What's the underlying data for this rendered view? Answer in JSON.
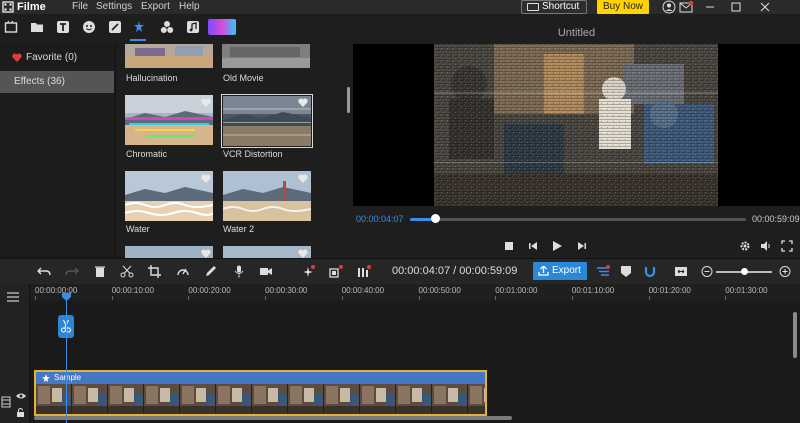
{
  "app": {
    "name": "Filme",
    "menu": [
      "File",
      "Settings",
      "Export",
      "Help"
    ],
    "shortcut_label": "Shortcut",
    "buy_label": "Buy Now",
    "accent": "#3a8ee6",
    "buy_color": "#ffd400"
  },
  "toolbar": {
    "icons": [
      "media-icon",
      "folder-icon",
      "text-icon",
      "sticker-icon",
      "transition-icon",
      "effects-icon",
      "elements-icon",
      "music-icon",
      "filter-icon"
    ],
    "active": "effects-icon"
  },
  "sidebar": {
    "items": [
      {
        "label": "Favorite (0)",
        "icon": "heart-icon"
      },
      {
        "label": "Effects (36)"
      }
    ],
    "active_index": 1
  },
  "effects": [
    {
      "label": "Hallucination"
    },
    {
      "label": "Old Movie"
    },
    {
      "label": "Chromatic"
    },
    {
      "label": "VCR Distortion"
    },
    {
      "label": "Water"
    },
    {
      "label": "Water 2"
    }
  ],
  "preview": {
    "title": "Untitled",
    "current_time": "00:00:04:07",
    "total_time": "00:00:59:09",
    "progress": 0.074
  },
  "timeline": {
    "time_display": "00:00:04:07 / 00:00:59:09",
    "export_label": "Export",
    "ruler": [
      "00:00:00:00",
      "00:00:10:00",
      "00:00:20:00",
      "00:00:30:00",
      "00:00:40:00",
      "00:00:50:00",
      "00:01:00:00",
      "00:01:10:00",
      "00:01:20:00",
      "00:01:30:00"
    ],
    "clip_name": "Sample",
    "zoom": 0.5
  }
}
